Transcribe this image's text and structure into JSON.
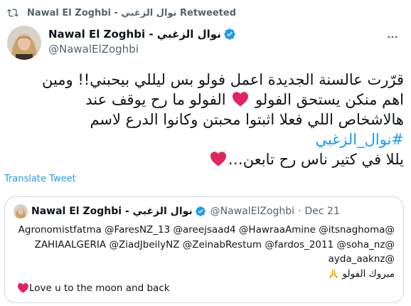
{
  "retweet": {
    "text": "Nawal El Zoghbi - نوال الزغبي Retweeted",
    "icon": "retweet-icon"
  },
  "author": {
    "display_name": "Nawal El Zoghbi - نوال الزغبي",
    "handle": "@NawalElZoghbi",
    "verified": true
  },
  "tweet": {
    "line1": "قرّرت عالسنة الجديدة اعمل فولو بس ليللي بيحبني!! ومين",
    "line2_a": "اهم منكن يستحق الفولو",
    "line2_b": "الفولو ما رح يوقف عند",
    "line3": "هالاشخاص اللي فعلا اثبتوا محبتن وكانوا الدرع لاسم",
    "hashtag": "#نوال_الزغبي",
    "line5": "يللا في كتير ناس رح تابعن…"
  },
  "translate_label": "Translate Tweet",
  "quote": {
    "display_name": "Nawal El Zoghbi - نوال الزغبي",
    "handle": "@NawalElZoghbi",
    "separator": "·",
    "date": "Dec 21",
    "mentions_line1": "@Agronomistfatma @FaresNZ_13 @areejsaad4 @HawraaAmine @itsnaghoma",
    "mentions_line2": "@ZAHIAALGERIA @ZiadJbeilyNZ @ZeinabRestum @fardos_2011 @soha_nz",
    "mentions_line3": "@ayda_aaknz",
    "arabic_line": "مبروك الفولو",
    "english_line": "Love u to the moon and back"
  },
  "colors": {
    "accent": "#1d9bf0",
    "secondary_text": "#536471",
    "heart": "#e0245e",
    "border": "#cfd9de"
  }
}
